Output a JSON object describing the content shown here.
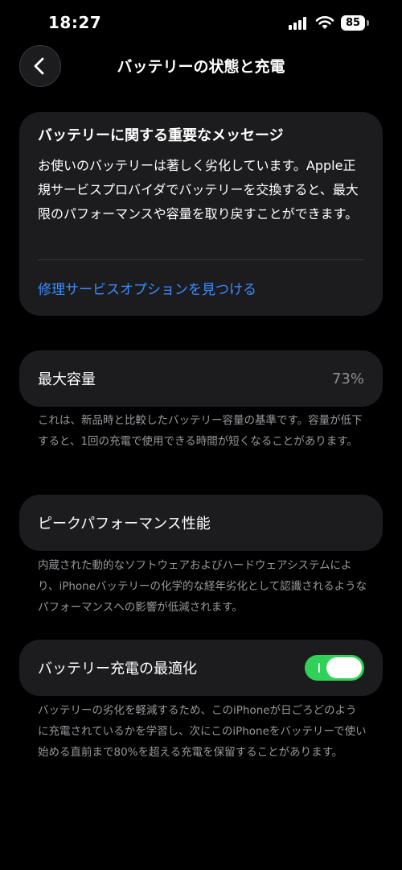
{
  "status_bar": {
    "time": "18:27",
    "battery_level": "85"
  },
  "nav": {
    "title": "バッテリーの状態と充電",
    "back_icon": "chevron-left-icon"
  },
  "message_card": {
    "title": "バッテリーに関する重要なメッセージ",
    "body": "お使いのバッテリーは著しく劣化しています。Apple正規サービスプロバイダでバッテリーを交換すると、最大限のパフォーマンスや容量を取り戻すことができます。",
    "link": "修理サービスオプションを見つける",
    "link_color": "#3a8cff"
  },
  "max_capacity": {
    "label": "最大容量",
    "value": "73%",
    "footnote": "これは、新品時と比較したバッテリー容量の基準です。容量が低下すると、1回の充電で使用できる時間が短くなることがあります。"
  },
  "peak_performance": {
    "label": "ピークパフォーマンス性能",
    "footnote": "内蔵された動的なソフトウェアおよびハードウェアシステムにより、iPhoneバッテリーの化学的な経年劣化として認識されるようなパフォーマンスへの影響が低減されます。"
  },
  "optimized_charging": {
    "label": "バッテリー充電の最適化",
    "enabled": true,
    "toggle_color": "#30d158",
    "footnote": "バッテリーの劣化を軽減するため、このiPhoneが日ごろどのように充電されているかを学習し、次にこのiPhoneをバッテリーで使い始める直前まで80%を超える充電を保留することがあります。"
  }
}
